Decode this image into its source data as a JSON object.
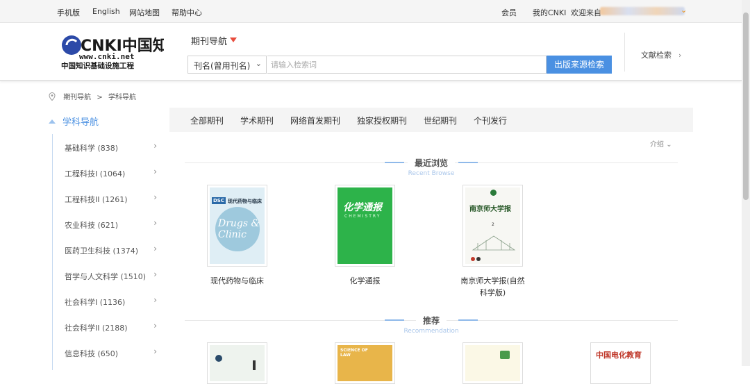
{
  "topbar": {
    "mobile": "手机版",
    "english": "English",
    "sitemap": "网站地图",
    "help": "帮助中心",
    "member": "会员",
    "my_cnki": "我的CNKI",
    "welcome": "欢迎来自"
  },
  "header": {
    "logo_main": "CNKI中国知网",
    "logo_url": "www.cnki.net",
    "logo_sub": "中国知识基础设施工程",
    "nav_label": "期刊导航",
    "search_field": "刊名(曾用刊名)",
    "search_placeholder": "请输入检索词",
    "search_button": "出版来源检索",
    "literature_search": "文献检索"
  },
  "breadcrumb": {
    "items": [
      "期刊导航",
      ">",
      "学科导航"
    ]
  },
  "sidebar": {
    "title": "学科导航",
    "items": [
      "基础科学 (838)",
      "工程科技I (1064)",
      "工程科技II (1261)",
      "农业科技 (621)",
      "医药卫生科技 (1374)",
      "哲学与人文科学 (1510)",
      "社会科学I (1136)",
      "社会科学II (2188)",
      "信息科技 (650)"
    ]
  },
  "tabs": [
    "全部期刊",
    "学术期刊",
    "网络首发期刊",
    "独家授权期刊",
    "世纪期刊",
    "个刊发行"
  ],
  "intro_label": "介绍",
  "recent": {
    "title_cn": "最近浏览",
    "title_en": "Recent Browse",
    "journals": [
      {
        "title": "现代药物与临床",
        "cover_text": "现代药物与临床",
        "cover_en": "Drugs & Clinic",
        "cover_badge": "DSC"
      },
      {
        "title": "化学通报",
        "cover_text": "化学通报",
        "cover_en": "CHEMISTRY"
      },
      {
        "title": "南京师大学报(自然科学版)",
        "cover_text": "南京师大学报",
        "cover_issue": "2"
      }
    ]
  },
  "recommend": {
    "title_cn": "推荐",
    "title_en": "Recommendation",
    "covers": [
      {
        "cover_text": ""
      },
      {
        "cover_text": "SCIENCE OF LAW"
      },
      {
        "cover_text": ""
      },
      {
        "cover_text": "中国电化教育"
      }
    ]
  },
  "colors": {
    "accent": "#4a90e2",
    "nav_triangle": "#e84c3d",
    "chem_green": "#2db34a",
    "drugs_blue": "#6aa8c8"
  },
  "icons": [
    "location-pin-icon",
    "chevron-right-icon",
    "chevron-down-icon",
    "triangle-down-icon",
    "collapse-up-icon"
  ]
}
